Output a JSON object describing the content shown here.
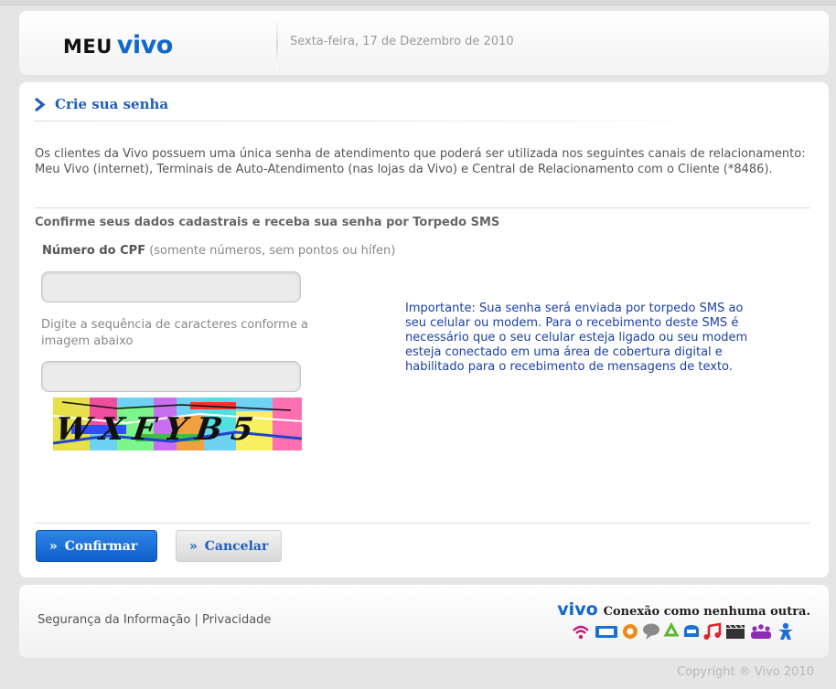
{
  "header": {
    "logo_meu": "MEU",
    "logo_vivo": "vivo",
    "date": "Sexta-feira, 17 de Dezembro de 2010"
  },
  "section": {
    "title": "Crie sua senha",
    "intro": "Os clientes da Vivo possuem uma única senha de atendimento que poderá ser utilizada nos seguintes canais de relacionamento: Meu Vivo (internet), Terminais de Auto-Atendimento (nas lojas da Vivo) e Central de Relacionamento com o Cliente (*8486).",
    "subheading": "Confirme seus dados cadastrais e receba sua senha por Torpedo SMS"
  },
  "form": {
    "cpf_label": "Número do CPF",
    "cpf_hint": " (somente números, sem pontos ou hífen)",
    "cpf_value": "",
    "captcha_label": "Digite a sequência de caracteres conforme a imagem abaixo",
    "captcha_value": "",
    "captcha_text": "WXFYB5"
  },
  "info": {
    "important": "Importante: Sua senha será enviada por torpedo SMS ao seu celular ou modem. Para o recebimento deste SMS é necessário que o seu celular esteja ligado ou seu modem esteja conectado em uma área de cobertura digital e habilitado para o recebimento de mensagens de texto."
  },
  "buttons": {
    "arrows": "»",
    "confirm": "Confirmar",
    "cancel": "Cancelar"
  },
  "footer": {
    "security": "Segurança da Informação",
    "separator": " | ",
    "privacy": "Privacidade",
    "brand": "vivo",
    "slogan": "Conexão como nenhuma outra.",
    "copyright": "Copyright ® Vivo 2010"
  },
  "colors": {
    "brand_blue": "#1168c9",
    "title_blue": "#1e5ebd",
    "info_blue": "#1b3fa8",
    "background": "#e5e5e5"
  },
  "icons": [
    "wifi-icon",
    "screen-icon",
    "at-icon",
    "chat-icon",
    "recycle-icon",
    "cloud-icon",
    "music-icon",
    "film-icon",
    "people-icon",
    "person-icon"
  ]
}
